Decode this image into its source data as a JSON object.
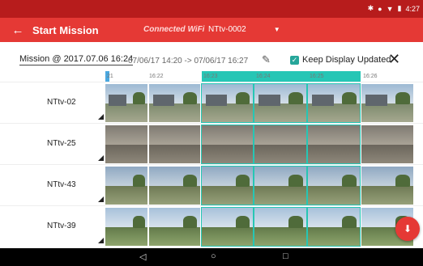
{
  "status_bar": {
    "time": "4:27",
    "icons": [
      "bluetooth-icon",
      "circle-icon",
      "wifi-icon",
      "battery-icon"
    ]
  },
  "app_bar": {
    "title": "Start Mission",
    "connected_label": "Connected WiFi",
    "wifi_value": "NTtv-0002",
    "bg_color": "#e53935"
  },
  "mission": {
    "name": "Mission @ 2017.07.06 16:24",
    "range": "07/06/17 14:20 -> 07/06/17 16:27",
    "keep_display_label": "Keep Display Updated",
    "keep_display_checked": true
  },
  "timeline": {
    "ticks": [
      "21",
      "16:22",
      "16:23",
      "16:24",
      "16:25",
      "16:26"
    ],
    "selection_color": "#26c6b5"
  },
  "grid": {
    "rows": [
      {
        "label": "NTtv-02"
      },
      {
        "label": "NTtv-25"
      },
      {
        "label": "NTtv-43"
      },
      {
        "label": "NTtv-39"
      }
    ]
  },
  "nav": {
    "back": "◁",
    "home": "○",
    "recent": "□"
  },
  "fab": {
    "icon": "download-icon"
  }
}
